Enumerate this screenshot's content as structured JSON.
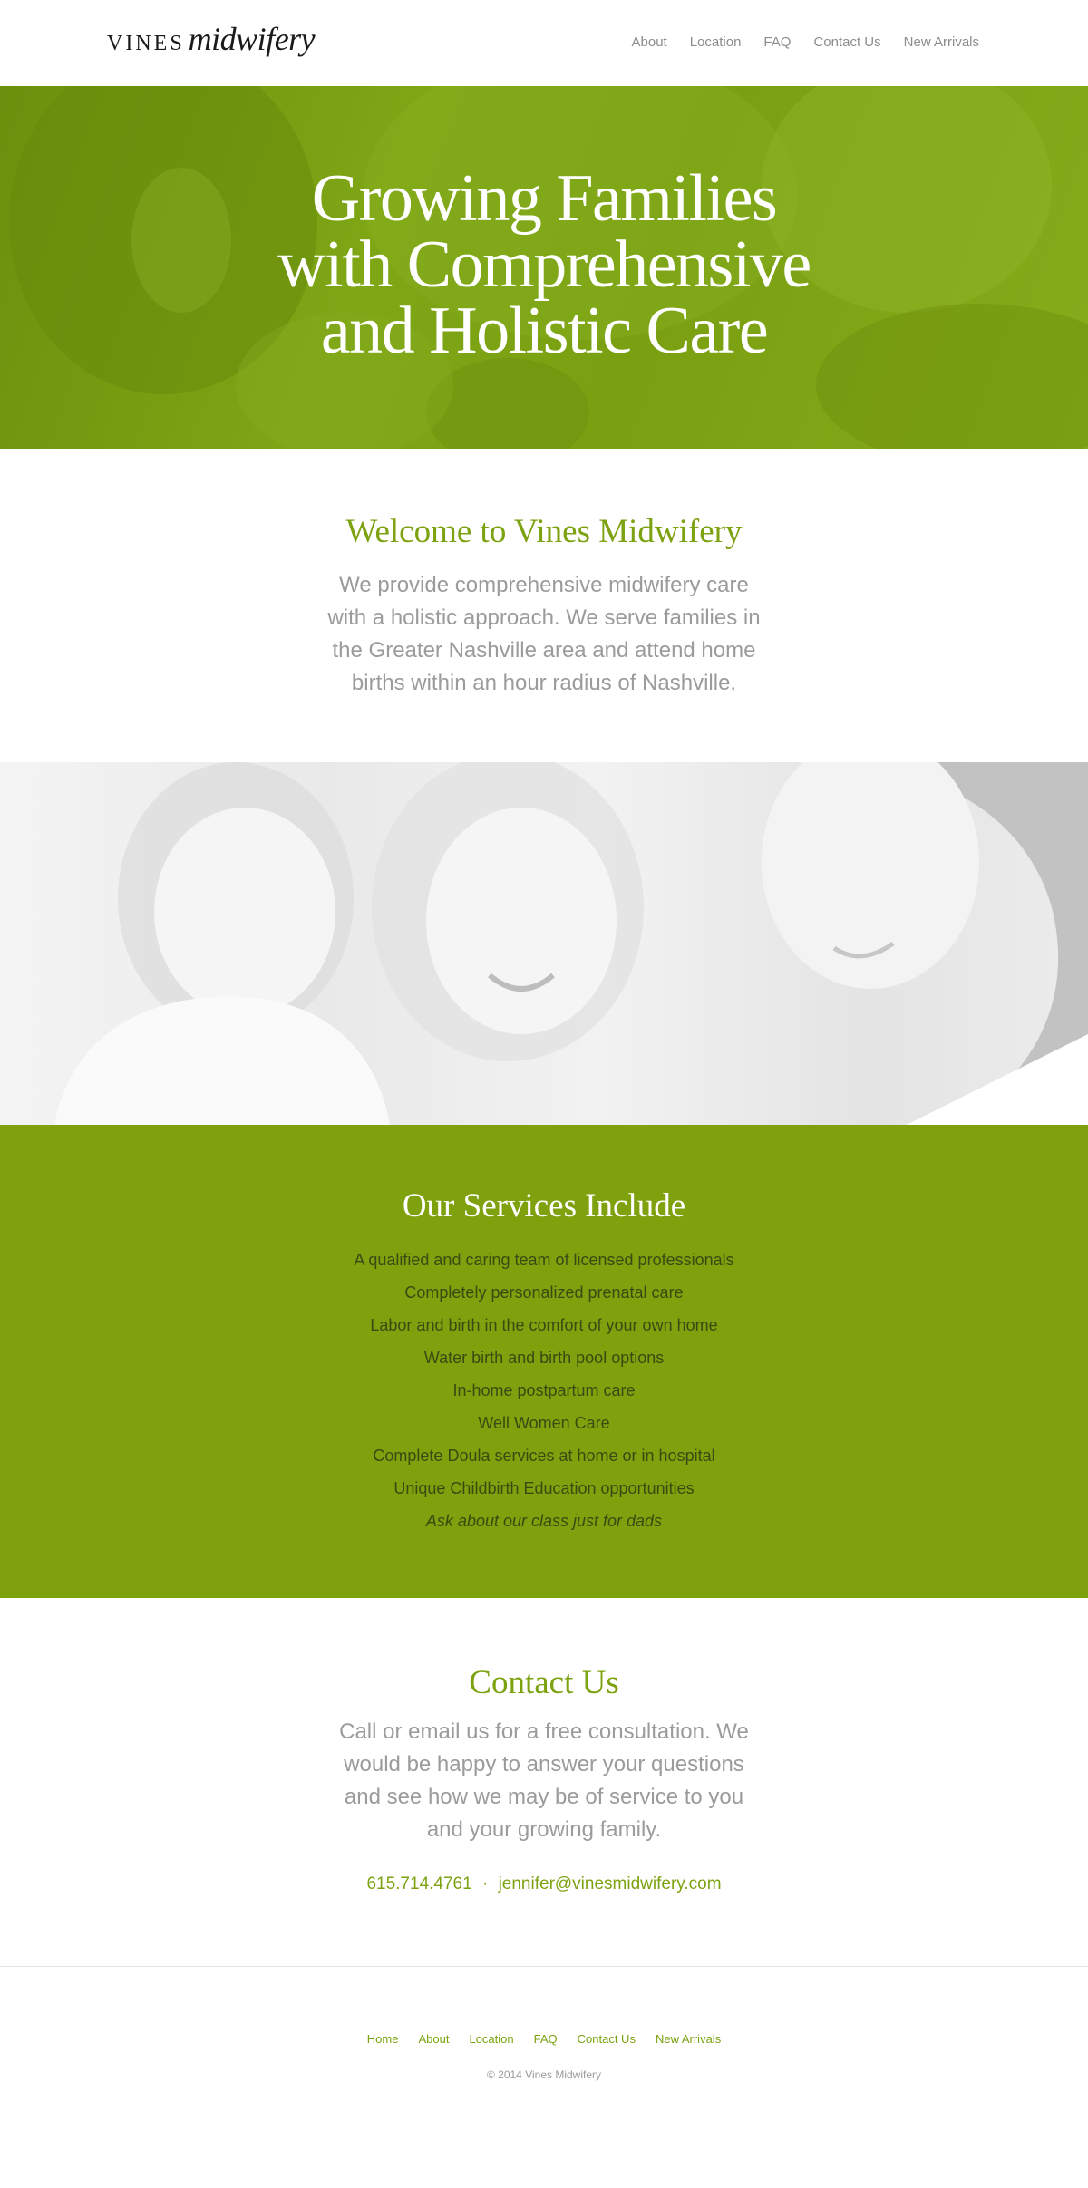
{
  "header": {
    "logo_caps": "VINES",
    "logo_script": "midwifery",
    "nav": [
      "About",
      "Location",
      "FAQ",
      "Contact Us",
      "New Arrivals"
    ]
  },
  "hero": {
    "lines": [
      "Growing Families",
      "with Comprehensive",
      "and Holistic Care"
    ],
    "overlay_color": "#7da210"
  },
  "welcome": {
    "title": "Welcome to Vines Midwifery",
    "body": "We provide comprehensive midwifery care with a holistic approach. We serve families in the Greater Nashville area and attend home births within an hour radius of Nashville."
  },
  "services": {
    "title": "Our Services Include",
    "items": [
      "A qualified and caring team of licensed professionals",
      "Completely personalized prenatal care",
      "Labor and birth in the comfort of your own home",
      "Water birth and birth pool options",
      "In-home postpartum care",
      "Well Women Care",
      "Complete Doula services at home or in hospital",
      "Unique Childbirth Education opportunities",
      "Ask about our class just for dads"
    ],
    "background": "#7fa10d"
  },
  "contact": {
    "title": "Contact Us",
    "body": "Call or email us for a free consultation. We would be happy to answer your questions and see how we may be of service to you and your growing family.",
    "phone": "615.714.4761",
    "separator": "·",
    "email": "jennifer@vinesmidwifery.com"
  },
  "footer": {
    "nav": [
      "Home",
      "About",
      "Location",
      "FAQ",
      "Contact Us",
      "New Arrivals"
    ],
    "copyright": "© 2014 Vines Midwifery"
  },
  "colors": {
    "accent": "#7da210",
    "text_gray": "#9b9b9b"
  }
}
